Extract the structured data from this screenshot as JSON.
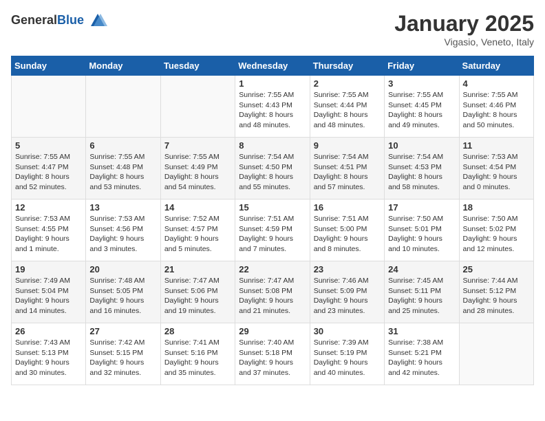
{
  "logo": {
    "general": "General",
    "blue": "Blue"
  },
  "header": {
    "month": "January 2025",
    "location": "Vigasio, Veneto, Italy"
  },
  "weekdays": [
    "Sunday",
    "Monday",
    "Tuesday",
    "Wednesday",
    "Thursday",
    "Friday",
    "Saturday"
  ],
  "weeks": [
    [
      {
        "day": "",
        "info": ""
      },
      {
        "day": "",
        "info": ""
      },
      {
        "day": "",
        "info": ""
      },
      {
        "day": "1",
        "info": "Sunrise: 7:55 AM\nSunset: 4:43 PM\nDaylight: 8 hours\nand 48 minutes."
      },
      {
        "day": "2",
        "info": "Sunrise: 7:55 AM\nSunset: 4:44 PM\nDaylight: 8 hours\nand 48 minutes."
      },
      {
        "day": "3",
        "info": "Sunrise: 7:55 AM\nSunset: 4:45 PM\nDaylight: 8 hours\nand 49 minutes."
      },
      {
        "day": "4",
        "info": "Sunrise: 7:55 AM\nSunset: 4:46 PM\nDaylight: 8 hours\nand 50 minutes."
      }
    ],
    [
      {
        "day": "5",
        "info": "Sunrise: 7:55 AM\nSunset: 4:47 PM\nDaylight: 8 hours\nand 52 minutes."
      },
      {
        "day": "6",
        "info": "Sunrise: 7:55 AM\nSunset: 4:48 PM\nDaylight: 8 hours\nand 53 minutes."
      },
      {
        "day": "7",
        "info": "Sunrise: 7:55 AM\nSunset: 4:49 PM\nDaylight: 8 hours\nand 54 minutes."
      },
      {
        "day": "8",
        "info": "Sunrise: 7:54 AM\nSunset: 4:50 PM\nDaylight: 8 hours\nand 55 minutes."
      },
      {
        "day": "9",
        "info": "Sunrise: 7:54 AM\nSunset: 4:51 PM\nDaylight: 8 hours\nand 57 minutes."
      },
      {
        "day": "10",
        "info": "Sunrise: 7:54 AM\nSunset: 4:53 PM\nDaylight: 8 hours\nand 58 minutes."
      },
      {
        "day": "11",
        "info": "Sunrise: 7:53 AM\nSunset: 4:54 PM\nDaylight: 9 hours\nand 0 minutes."
      }
    ],
    [
      {
        "day": "12",
        "info": "Sunrise: 7:53 AM\nSunset: 4:55 PM\nDaylight: 9 hours\nand 1 minute."
      },
      {
        "day": "13",
        "info": "Sunrise: 7:53 AM\nSunset: 4:56 PM\nDaylight: 9 hours\nand 3 minutes."
      },
      {
        "day": "14",
        "info": "Sunrise: 7:52 AM\nSunset: 4:57 PM\nDaylight: 9 hours\nand 5 minutes."
      },
      {
        "day": "15",
        "info": "Sunrise: 7:51 AM\nSunset: 4:59 PM\nDaylight: 9 hours\nand 7 minutes."
      },
      {
        "day": "16",
        "info": "Sunrise: 7:51 AM\nSunset: 5:00 PM\nDaylight: 9 hours\nand 8 minutes."
      },
      {
        "day": "17",
        "info": "Sunrise: 7:50 AM\nSunset: 5:01 PM\nDaylight: 9 hours\nand 10 minutes."
      },
      {
        "day": "18",
        "info": "Sunrise: 7:50 AM\nSunset: 5:02 PM\nDaylight: 9 hours\nand 12 minutes."
      }
    ],
    [
      {
        "day": "19",
        "info": "Sunrise: 7:49 AM\nSunset: 5:04 PM\nDaylight: 9 hours\nand 14 minutes."
      },
      {
        "day": "20",
        "info": "Sunrise: 7:48 AM\nSunset: 5:05 PM\nDaylight: 9 hours\nand 16 minutes."
      },
      {
        "day": "21",
        "info": "Sunrise: 7:47 AM\nSunset: 5:06 PM\nDaylight: 9 hours\nand 19 minutes."
      },
      {
        "day": "22",
        "info": "Sunrise: 7:47 AM\nSunset: 5:08 PM\nDaylight: 9 hours\nand 21 minutes."
      },
      {
        "day": "23",
        "info": "Sunrise: 7:46 AM\nSunset: 5:09 PM\nDaylight: 9 hours\nand 23 minutes."
      },
      {
        "day": "24",
        "info": "Sunrise: 7:45 AM\nSunset: 5:11 PM\nDaylight: 9 hours\nand 25 minutes."
      },
      {
        "day": "25",
        "info": "Sunrise: 7:44 AM\nSunset: 5:12 PM\nDaylight: 9 hours\nand 28 minutes."
      }
    ],
    [
      {
        "day": "26",
        "info": "Sunrise: 7:43 AM\nSunset: 5:13 PM\nDaylight: 9 hours\nand 30 minutes."
      },
      {
        "day": "27",
        "info": "Sunrise: 7:42 AM\nSunset: 5:15 PM\nDaylight: 9 hours\nand 32 minutes."
      },
      {
        "day": "28",
        "info": "Sunrise: 7:41 AM\nSunset: 5:16 PM\nDaylight: 9 hours\nand 35 minutes."
      },
      {
        "day": "29",
        "info": "Sunrise: 7:40 AM\nSunset: 5:18 PM\nDaylight: 9 hours\nand 37 minutes."
      },
      {
        "day": "30",
        "info": "Sunrise: 7:39 AM\nSunset: 5:19 PM\nDaylight: 9 hours\nand 40 minutes."
      },
      {
        "day": "31",
        "info": "Sunrise: 7:38 AM\nSunset: 5:21 PM\nDaylight: 9 hours\nand 42 minutes."
      },
      {
        "day": "",
        "info": ""
      }
    ]
  ]
}
